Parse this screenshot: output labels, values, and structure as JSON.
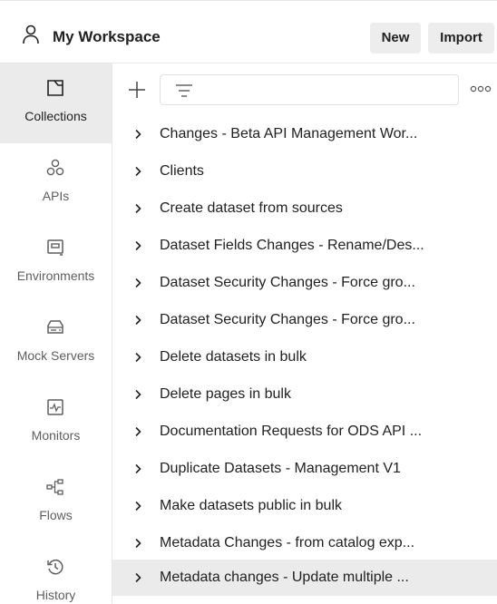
{
  "header": {
    "workspace_title": "My Workspace",
    "new_label": "New",
    "import_label": "Import"
  },
  "sidebar": {
    "items": [
      {
        "label": "Collections",
        "icon": "collections-icon",
        "active": true
      },
      {
        "label": "APIs",
        "icon": "apis-icon",
        "active": false
      },
      {
        "label": "Environments",
        "icon": "environments-icon",
        "active": false
      },
      {
        "label": "Mock Servers",
        "icon": "mock-servers-icon",
        "active": false
      },
      {
        "label": "Monitors",
        "icon": "monitors-icon",
        "active": false
      },
      {
        "label": "Flows",
        "icon": "flows-icon",
        "active": false
      },
      {
        "label": "History",
        "icon": "history-icon",
        "active": false
      }
    ]
  },
  "toolbar": {
    "search_placeholder": ""
  },
  "collections": [
    {
      "name": "Changes - Beta API Management Wor...",
      "selected": false
    },
    {
      "name": "Clients",
      "selected": false
    },
    {
      "name": "Create dataset from sources",
      "selected": false
    },
    {
      "name": "Dataset Fields Changes - Rename/Des...",
      "selected": false
    },
    {
      "name": "Dataset Security Changes - Force gro...",
      "selected": false
    },
    {
      "name": "Dataset Security Changes - Force gro...",
      "selected": false
    },
    {
      "name": "Delete datasets in bulk",
      "selected": false
    },
    {
      "name": "Delete pages in bulk",
      "selected": false
    },
    {
      "name": "Documentation Requests for ODS API ...",
      "selected": false
    },
    {
      "name": "Duplicate Datasets - Management V1",
      "selected": false
    },
    {
      "name": "Make datasets public in bulk",
      "selected": false
    },
    {
      "name": "Metadata Changes - from catalog exp...",
      "selected": false
    },
    {
      "name": "Metadata changes - Update multiple ...",
      "selected": true
    }
  ],
  "colors": {
    "active_bg": "#ebebeb",
    "text": "#212121",
    "muted": "#5e5e5e",
    "button_bg": "#ededed"
  }
}
